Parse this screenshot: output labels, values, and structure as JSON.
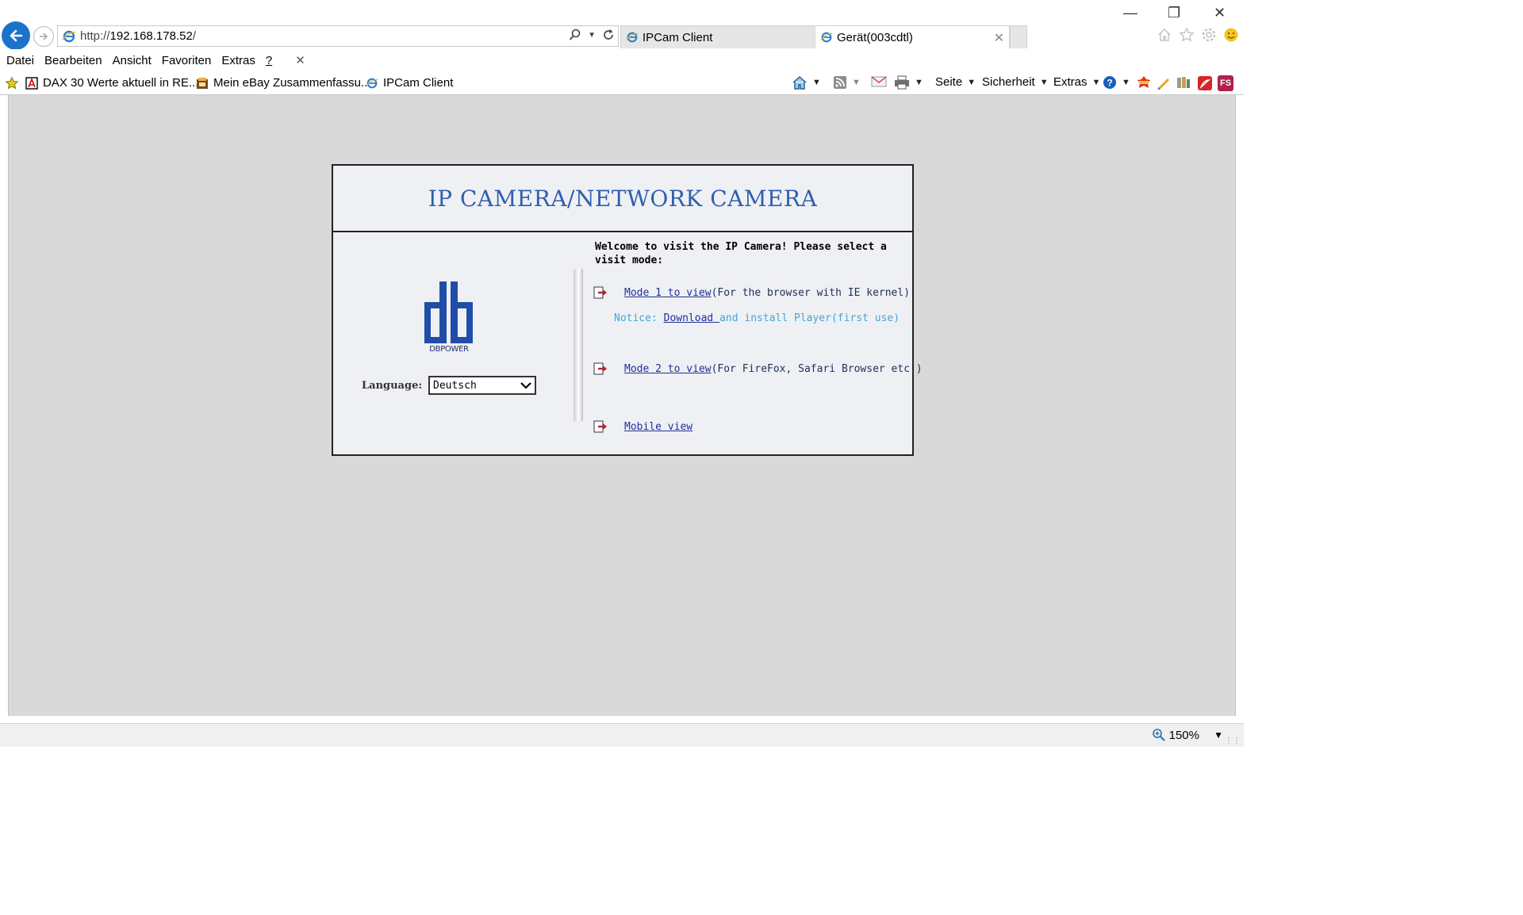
{
  "browser": {
    "url_prefix": "http://",
    "url_host": "192.168.178.52",
    "url_suffix": "/",
    "tabs": [
      {
        "label": "IPCam Client"
      },
      {
        "label": "Gerät(003cdtl)"
      }
    ],
    "menu": [
      {
        "label": "Datei"
      },
      {
        "label": "Bearbeiten"
      },
      {
        "label": "Ansicht"
      },
      {
        "label": "Favoriten"
      },
      {
        "label": "Extras"
      },
      {
        "label": "?"
      }
    ],
    "favorites": [
      {
        "label": "DAX 30 Werte aktuell in RE..."
      },
      {
        "label": "Mein eBay Zusammenfassu..."
      },
      {
        "label": "IPCam Client"
      }
    ],
    "commands": {
      "page": "Seite",
      "security": "Sicherheit",
      "extras": "Extras",
      "fs_badge": "FS"
    },
    "zoom": "150%"
  },
  "camera_page": {
    "title": "IP CAMERA/NETWORK CAMERA",
    "brand": "DBPOWER",
    "language_label": "Language:",
    "language_value": "Deutsch",
    "welcome": "Welcome to visit the IP Camera! Please select a visit mode:",
    "mode1_link": "Mode 1 to view ",
    "mode1_desc": "(For the browser with IE kernel)",
    "notice_prefix": "Notice: ",
    "notice_link": "Download ",
    "notice_suffix": "and install Player(first use)",
    "mode2_link": "Mode 2 to view ",
    "mode2_desc": "(For FireFox, Safari Browser etc.)",
    "mobile_link": "Mobile view"
  }
}
